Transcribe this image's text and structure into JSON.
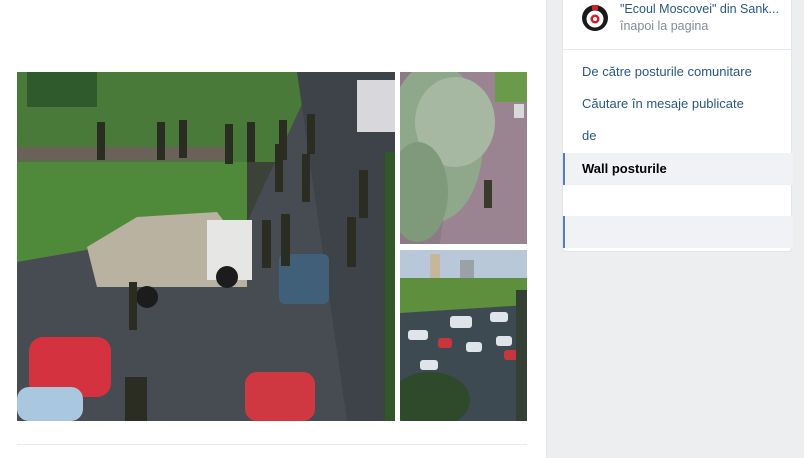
{
  "post": {
    "partial_text": "",
    "photos": [
      {
        "name": "police-convoy-street-photo"
      },
      {
        "name": "tree-courtyard-photo"
      },
      {
        "name": "parking-lot-photo"
      }
    ]
  },
  "sidebar": {
    "group_name": "\"Ecoul Moscovei\" din Sank...",
    "back_label": "înapoi la pagina",
    "items": [
      {
        "label": "De către posturile comunitare",
        "active": false
      },
      {
        "label": "Căutare în mesaje publicate",
        "active": false
      },
      {
        "label": "de",
        "active": false
      },
      {
        "label": "Wall posturile",
        "active": true
      }
    ]
  },
  "colors": {
    "link": "#2a5885",
    "muted": "#818c99",
    "accent": "#5181b8",
    "background": "#edeef0"
  }
}
